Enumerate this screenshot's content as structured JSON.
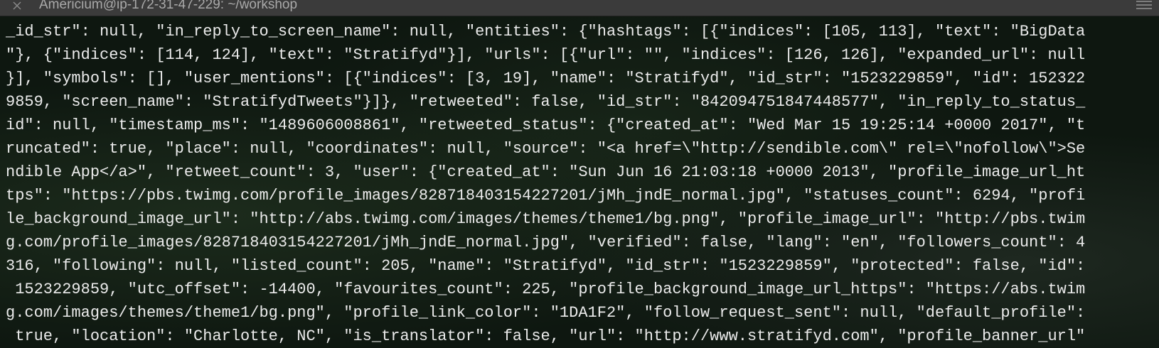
{
  "window": {
    "title": "Americium@ip-172-31-47-229: ~/workshop",
    "close_icon": "close-icon",
    "menu_icon": "hamburger-menu-icon"
  },
  "terminal": {
    "lines": [
      "_id_str\": null, \"in_reply_to_screen_name\": null, \"entities\": {\"hashtags\": [{\"indices\": [105, 113], \"text\": \"BigData",
      "\"}, {\"indices\": [114, 124], \"text\": \"Stratifyd\"}], \"urls\": [{\"url\": \"\", \"indices\": [126, 126], \"expanded_url\": null",
      "}], \"symbols\": [], \"user_mentions\": [{\"indices\": [3, 19], \"name\": \"Stratifyd\", \"id_str\": \"1523229859\", \"id\": 152322",
      "9859, \"screen_name\": \"StratifydTweets\"}]}, \"retweeted\": false, \"id_str\": \"842094751847448577\", \"in_reply_to_status_",
      "id\": null, \"timestamp_ms\": \"1489606008861\", \"retweeted_status\": {\"created_at\": \"Wed Mar 15 19:25:14 +0000 2017\", \"t",
      "runcated\": true, \"place\": null, \"coordinates\": null, \"source\": \"<a href=\\\"http://sendible.com\\\" rel=\\\"nofollow\\\">Se",
      "ndible App</a>\", \"retweet_count\": 3, \"user\": {\"created_at\": \"Sun Jun 16 21:03:18 +0000 2013\", \"profile_image_url_ht",
      "tps\": \"https://pbs.twimg.com/profile_images/828718403154227201/jMh_jndE_normal.jpg\", \"statuses_count\": 6294, \"profi",
      "le_background_image_url\": \"http://abs.twimg.com/images/themes/theme1/bg.png\", \"profile_image_url\": \"http://pbs.twim",
      "g.com/profile_images/828718403154227201/jMh_jndE_normal.jpg\", \"verified\": false, \"lang\": \"en\", \"followers_count\": 4",
      "316, \"following\": null, \"listed_count\": 205, \"name\": \"Stratifyd\", \"id_str\": \"1523229859\", \"protected\": false, \"id\":",
      " 1523229859, \"utc_offset\": -14400, \"favourites_count\": 225, \"profile_background_image_url_https\": \"https://abs.twim",
      "g.com/images/themes/theme1/bg.png\", \"profile_link_color\": \"1DA1F2\", \"follow_request_sent\": null, \"default_profile\":",
      " true, \"location\": \"Charlotte, NC\", \"is_translator\": false, \"url\": \"http://www.stratifyd.com\", \"profile_banner_url\""
    ]
  }
}
